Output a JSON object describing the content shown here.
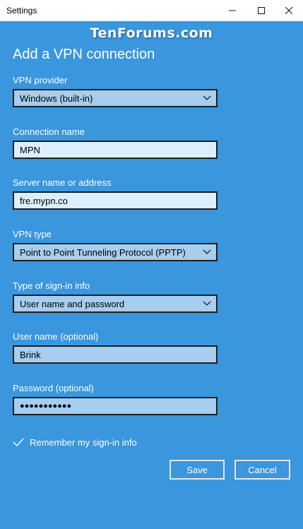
{
  "window": {
    "title": "Settings",
    "controls": {
      "minimize": "─",
      "maximize": "☐",
      "close": "✕"
    }
  },
  "watermark": "TenForums.com",
  "heading": "Add a VPN connection",
  "fields": {
    "vpn_provider": {
      "label": "VPN provider",
      "value": "Windows (built-in)"
    },
    "connection_name": {
      "label": "Connection name",
      "value": "MPN"
    },
    "server_address": {
      "label": "Server name or address",
      "value": "fre.mypn.co"
    },
    "vpn_type": {
      "label": "VPN type",
      "value": "Point to Point Tunneling Protocol (PPTP)"
    },
    "signin_type": {
      "label": "Type of sign-in info",
      "value": "User name and password"
    },
    "username": {
      "label": "User name (optional)",
      "value": "Brink"
    },
    "password": {
      "label": "Password (optional)",
      "value": "●●●●●●●●●●●"
    }
  },
  "remember": {
    "label": "Remember my sign-in info",
    "checked": true
  },
  "buttons": {
    "save": "Save",
    "cancel": "Cancel"
  },
  "colors": {
    "background": "#3a96dd",
    "select_fill": "#a7cdef",
    "input_fill": "#dcefff"
  }
}
